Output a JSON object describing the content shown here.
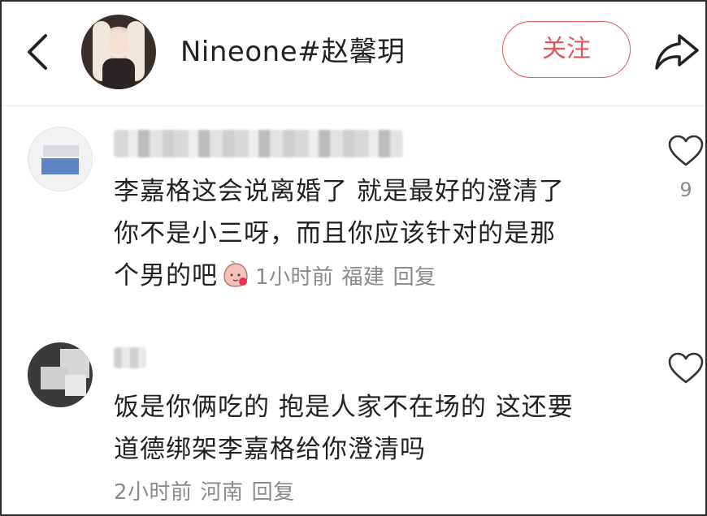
{
  "header": {
    "back_icon": "chevron-left-icon",
    "username": "Nineone#赵馨玥",
    "follow_label": "关注",
    "share_icon": "share-arrow-icon",
    "accent_color": "#e2565c"
  },
  "comments": [
    {
      "text_lines": [
        "李嘉格这会说离婚了 就是最好的澄清了",
        "你不是小三呀，而且你应该针对的是那",
        "个男的吧"
      ],
      "emoji": "peach-face-emoji",
      "time": "1小时前",
      "location": "福建",
      "reply_label": "回复",
      "likes": "9"
    },
    {
      "text_lines": [
        "饭是你俩吃的 抱是人家不在场的 这还要",
        "道德绑架李嘉格给你澄清吗"
      ],
      "time": "2小时前",
      "location": "河南",
      "reply_label": "回复",
      "likes": ""
    }
  ]
}
